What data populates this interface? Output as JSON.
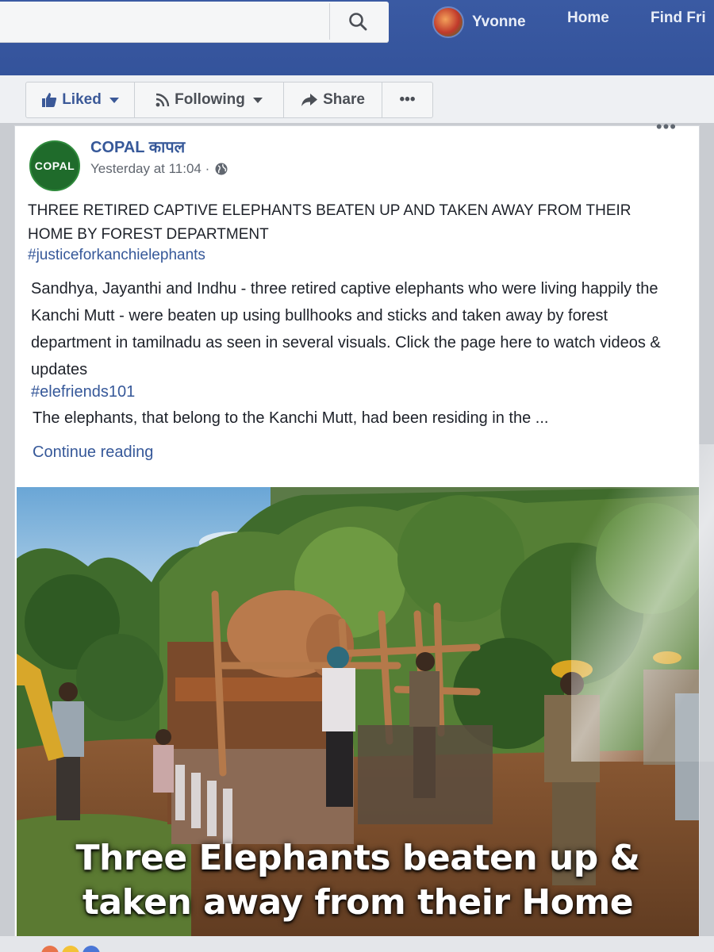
{
  "nav": {
    "user_name": "Yvonne",
    "home": "Home",
    "find_friends": "Find Fri"
  },
  "actions": {
    "liked": "Liked",
    "following": "Following",
    "share": "Share",
    "more": "•••"
  },
  "post": {
    "more": "•••",
    "page_name": "COPAL कापल",
    "avatar_text": "COPAL",
    "timestamp": "Yesterday at 11:04 ·",
    "title": "THREE RETIRED CAPTIVE ELEPHANTS BEATEN UP AND TAKEN AWAY FROM THEIR HOME BY FOREST DEPARTMENT",
    "hashtag_1": "#justiceforkanchielephants",
    "body": "Sandhya, Jayanthi and Indhu - three retired captive elephants who were living happily the Kanchi Mutt - were beaten up using bullhooks and sticks and taken away by forest department in tamilnadu as seen in several visuals. Click the page here to watch videos & updates",
    "hashtag_2": "#elefriends101",
    "excerpt": "The elephants, that belong to the Kanchi Mutt, had been residing in the ...",
    "continue_reading": "Continue reading",
    "photo_caption_line1": "Three Elephants beaten up &",
    "photo_caption_line2": "taken away from their Home"
  },
  "colors": {
    "facebook_blue": "#3b5998",
    "link": "#365899"
  },
  "icons": [
    "search-icon",
    "thumbs-up-icon",
    "rss-icon",
    "share-arrow-icon",
    "globe-icon",
    "more-icon"
  ]
}
